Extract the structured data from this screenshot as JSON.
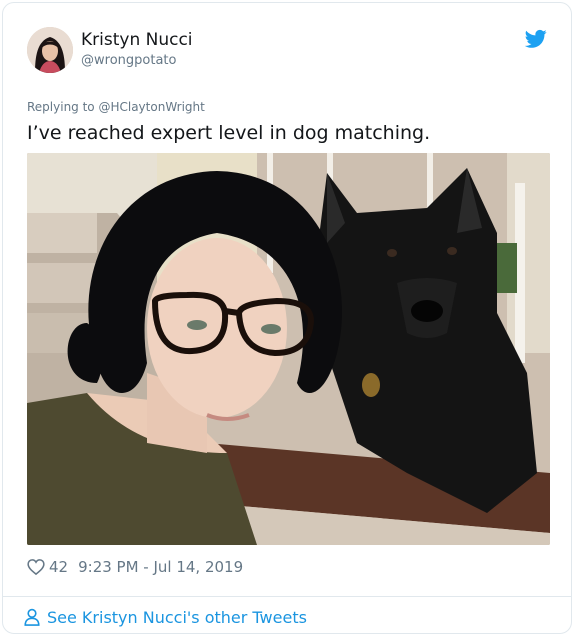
{
  "tweet": {
    "author": {
      "display_name": "Kristyn Nucci",
      "handle": "@wrongpotato"
    },
    "replying_to_prefix": "Replying to ",
    "replying_to_handle": "@HClaytonWright",
    "text": "I’ve reached expert level in dog matching.",
    "likes": "42",
    "timestamp": "9:23 PM - Jul 14, 2019",
    "more_tweets_label": "See Kristyn Nucci's other Tweets"
  },
  "icons": {
    "brand": "twitter-bird-icon",
    "like": "heart-icon",
    "profile": "person-icon"
  },
  "colors": {
    "accent": "#1da1f2",
    "link": "#1b95e0",
    "secondary_text": "#657786",
    "border": "#e1e8ed"
  }
}
